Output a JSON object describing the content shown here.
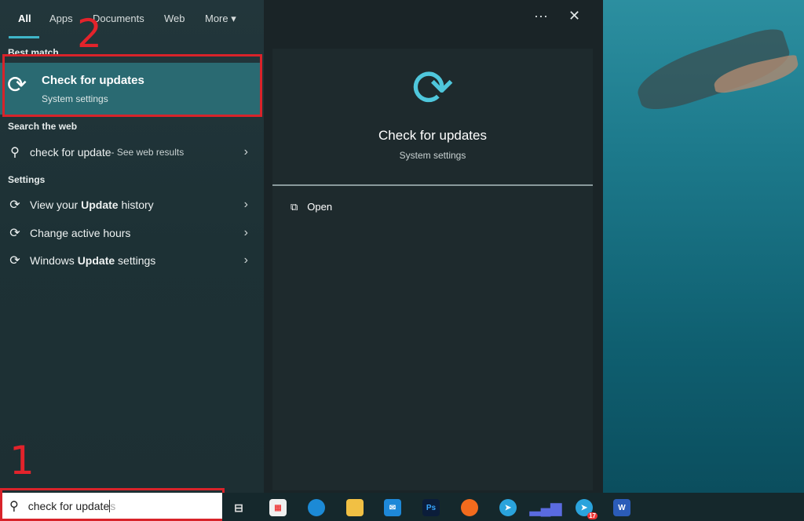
{
  "tabs": [
    "All",
    "Apps",
    "Documents",
    "Web",
    "More"
  ],
  "top_icons": {
    "more": "···",
    "close": "✕"
  },
  "sections": {
    "best_match": "Best match",
    "search_web": "Search the web",
    "settings": "Settings"
  },
  "best_match": {
    "title": "Check for updates",
    "subtitle": "System settings"
  },
  "web_result": {
    "query": "check for update",
    "suffix": " - See web results"
  },
  "settings_items": [
    {
      "pre": "View your ",
      "bold": "Update",
      "post": " history"
    },
    {
      "pre": "Change active hours",
      "bold": "",
      "post": ""
    },
    {
      "pre": "Windows ",
      "bold": "Update",
      "post": " settings"
    }
  ],
  "preview": {
    "title": "Check for updates",
    "subtitle": "System settings",
    "open_label": "Open"
  },
  "search_box": {
    "value": "check for update",
    "ghost": "s"
  },
  "annotations": {
    "step1": "1",
    "step2": "2",
    "color": "#d8232a"
  },
  "taskbar_icons": [
    "task-view",
    "microsoft-store",
    "edge",
    "file-explorer",
    "mail",
    "photoshop",
    "firefox",
    "telegram",
    "chart-app",
    "telegram-badge",
    "word"
  ],
  "badge_count": "17",
  "accent": "#3fb5c8"
}
